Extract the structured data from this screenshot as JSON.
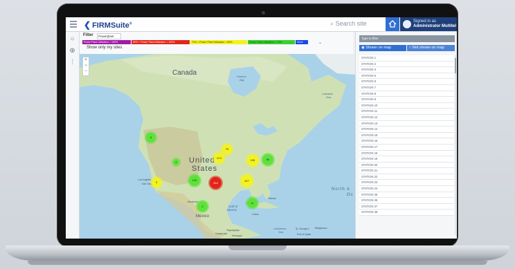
{
  "app": {
    "logo": "FIRMSuite",
    "trademark": "®"
  },
  "header": {
    "search_placeholder": "Search site",
    "signin_line1": "Signed in as",
    "signin_line2": "Administrator Multitel"
  },
  "filter": {
    "label": "Filter",
    "select_value": "Powerplant",
    "legend": [
      {
        "label": "Power Plant Utilization > 100%",
        "color": "#a21aa6"
      },
      {
        "label": "60% < Power Plant Utilization < 100%",
        "color": "#e2261b"
      },
      {
        "label": "70% < Power Plant Utilization < 80%",
        "color": "#f2f21a"
      },
      {
        "label": "Power Plant Utilization < 70%",
        "color": "#36d22a"
      },
      {
        "label": "None",
        "color": "#1a47e6"
      }
    ],
    "show_only_my_sites": "Show only my sites"
  },
  "map": {
    "zoom_in": "+",
    "zoom_reset": "○",
    "zoom_out": "−",
    "labels": {
      "canada": "Canada",
      "hudson": "Hudson",
      "bay": "Bay",
      "labrador": "Labrador",
      "sea": "Sea",
      "united": "United",
      "states": "States",
      "gulf": "Gulf of",
      "mexico_gulf": "Mexico",
      "mexico": "México",
      "cuba": "Cuba",
      "north_atlantic": "North A",
      "ocean": "Oc",
      "caribbean": "Caribbean",
      "sea2": "Sea",
      "los_angeles": "Los Angeles",
      "san_diego": "San Diego",
      "st_georges": "St. George's",
      "port_of_spain": "Port of Spain",
      "bridgetown": "Bridgetown",
      "tegucigalpa": "Tegucigalpa",
      "guatemala": "Guatemala",
      "managua": "Managua",
      "monterrey": "Monterrey",
      "havana": "Havana",
      "nassau": "Nassau"
    },
    "clusters": [
      {
        "value": "5",
        "color": "#5ee23a"
      },
      {
        "value": "2",
        "color": "#5ee23a"
      },
      {
        "value": "3",
        "color": "#f3f222"
      },
      {
        "value": "125",
        "color": "#5ee23a"
      },
      {
        "value": "310",
        "color": "#e3231a"
      },
      {
        "value": "75",
        "color": "#f3f222"
      },
      {
        "value": "474",
        "color": "#f3f222"
      },
      {
        "value": "105",
        "color": "#f3f222"
      },
      {
        "value": "60",
        "color": "#5ee23a"
      },
      {
        "value": "327",
        "color": "#f3f222"
      },
      {
        "value": "2",
        "color": "#5ee23a"
      },
      {
        "value": "11",
        "color": "#5ee23a"
      }
    ]
  },
  "panel": {
    "type_to_filter": "Type to filter",
    "shown_on_map": "Shown on map",
    "not_shown_on_map": "Not shown on map",
    "stations": [
      "STATION 1",
      "STATION 2",
      "STATION 3",
      "STATION 5",
      "STATION 6",
      "STATION 7",
      "STATION 8",
      "STATION 9",
      "STATION 10",
      "STATION 11",
      "STATION 12",
      "STATION 13",
      "STATION 14",
      "STATION 15",
      "STATION 16",
      "STATION 17",
      "STATION 18",
      "STATION 19",
      "STATION 20",
      "STATION 21",
      "STATION 22",
      "STATION 23",
      "STATION 24",
      "STATION 25",
      "STATION 26",
      "STATION 27",
      "STATION 28"
    ]
  }
}
